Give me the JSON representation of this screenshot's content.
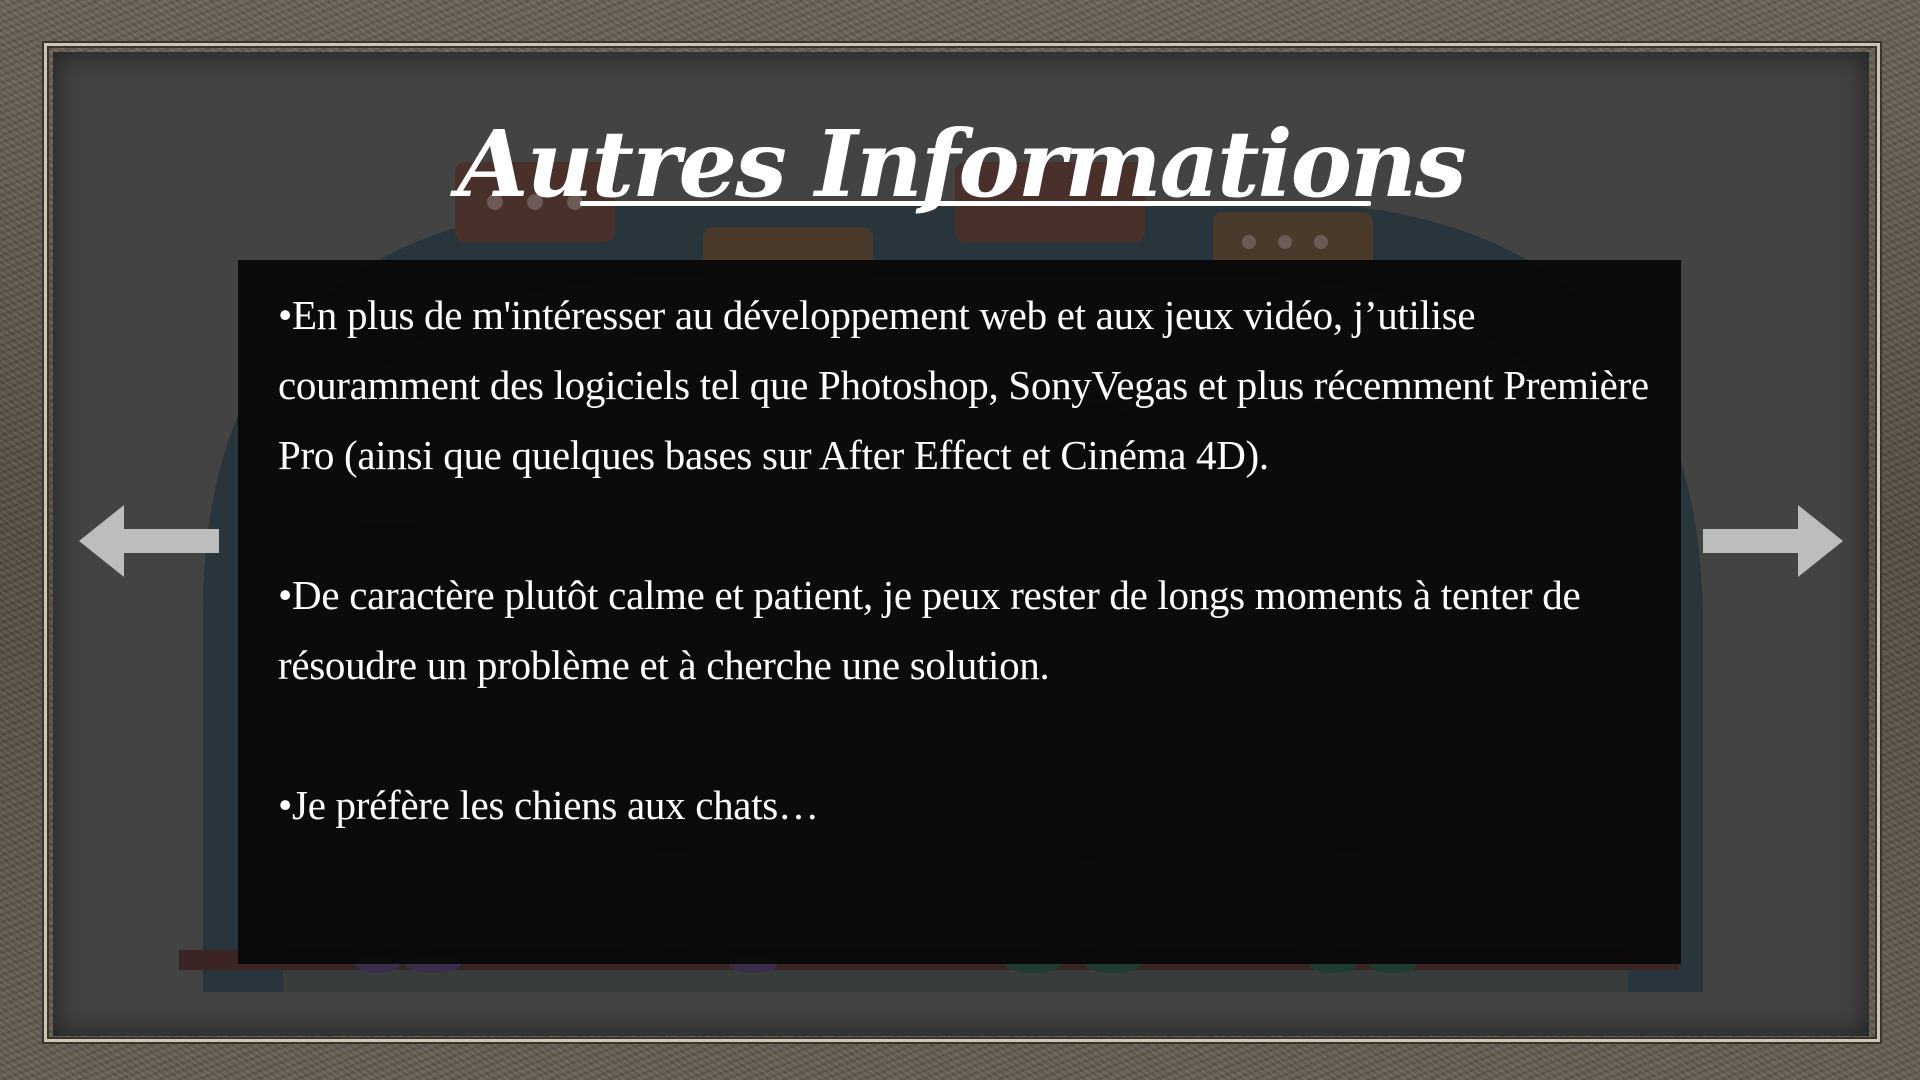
{
  "slide": {
    "title": "Autres Informations",
    "paragraphs": [
      "•En plus de m'intéresser au développement web et aux jeux vidéo, j’utilise couramment des logiciels tel que Photoshop, SonyVegas et plus récemment Première Pro (ainsi que quelques bases sur After Effect et Cinéma 4D).",
      "•De caractère plutôt calme et patient, je peux rester de longs moments à tenter de résoudre un problème et à cherche une solution.",
      "•Je préfère les chiens aux chats…"
    ]
  },
  "navigation": {
    "previous_icon": "arrow-left-icon",
    "next_icon": "arrow-right-icon"
  },
  "colors": {
    "board": "#434343",
    "content_box": "#080808",
    "text": "#ffffff",
    "arrow": "#bdbdbd"
  }
}
